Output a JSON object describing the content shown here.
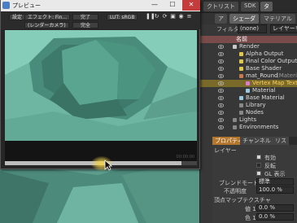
{
  "preview_window": {
    "title": "プレビュー",
    "toolbar": {
      "settings_label": "設定",
      "effect_label": "エフェクト: Fin...",
      "done_label": "完了",
      "lut_label": "LUT: sRGB",
      "render_camera_label": "(レンダーカメラ)",
      "complete_label": "完全"
    },
    "time_readout": "00:00:00",
    "progress": 0.92,
    "colors": {
      "titlebar": "#e9e9e9",
      "close": "#c43c3c",
      "render_bg": "#6fb9a5"
    }
  },
  "right_panel": {
    "top_tabs": [
      "クトリスト",
      "SDK",
      "タ"
    ],
    "sub_tabs": [
      "ア",
      "シェーダ",
      "マテリアル"
    ],
    "filter_label": "フィルター:",
    "filter_value": "(none)",
    "layer_value": "レイヤーを",
    "tree_header": "名前",
    "tree": [
      {
        "label": "Render",
        "depth": 0,
        "selected": false,
        "icon_color": "#c8c8c8"
      },
      {
        "label": "Alpha Output",
        "depth": 1,
        "selected": false,
        "icon_color": "#e0c84a"
      },
      {
        "label": "Final Color Output",
        "depth": 1,
        "selected": false,
        "icon_color": "#e0c84a"
      },
      {
        "label": "Base Shader",
        "depth": 1,
        "selected": false,
        "icon_color": "#e0c84a"
      },
      {
        "label": "mat_Round",
        "label_suffix": "(Material)",
        "depth": 1,
        "selected": false,
        "icon_color": "#c87a4a"
      },
      {
        "label": "Vertex Map Texture",
        "depth": 2,
        "selected": true,
        "icon_color": "#e07ad0"
      },
      {
        "label": "Material",
        "depth": 2,
        "selected": false,
        "icon_color": "#9ac8e0"
      },
      {
        "label": "Base Material",
        "depth": 1,
        "selected": false,
        "icon_color": "#9ac8e0"
      },
      {
        "label": "Library",
        "depth": 1,
        "selected": false,
        "icon_color": "#888888"
      },
      {
        "label": "Nodes",
        "depth": 1,
        "selected": false,
        "icon_color": "#888888"
      },
      {
        "label": "Lights",
        "depth": 0,
        "selected": false,
        "icon_color": "#888888"
      },
      {
        "label": "Environments",
        "depth": 0,
        "selected": false,
        "icon_color": "#888888"
      }
    ],
    "props_tabs": [
      "プロパティ",
      "チャンネル",
      "リス"
    ],
    "properties": {
      "section_layer": "レイヤー",
      "enable_label": "有効",
      "invert_label": "反転",
      "gl_label": "GL 表示",
      "blend_mode_label": "ブレンドモード",
      "blend_mode_value": "標準",
      "opacity_label": "不透明度",
      "opacity_value": "100.0 %",
      "section_vertex_map": "頂点マップテクスチャ",
      "value_label": "値 1",
      "value_value": "0.0 %",
      "color_label": "色 1",
      "color_value": "0.0 %"
    }
  }
}
